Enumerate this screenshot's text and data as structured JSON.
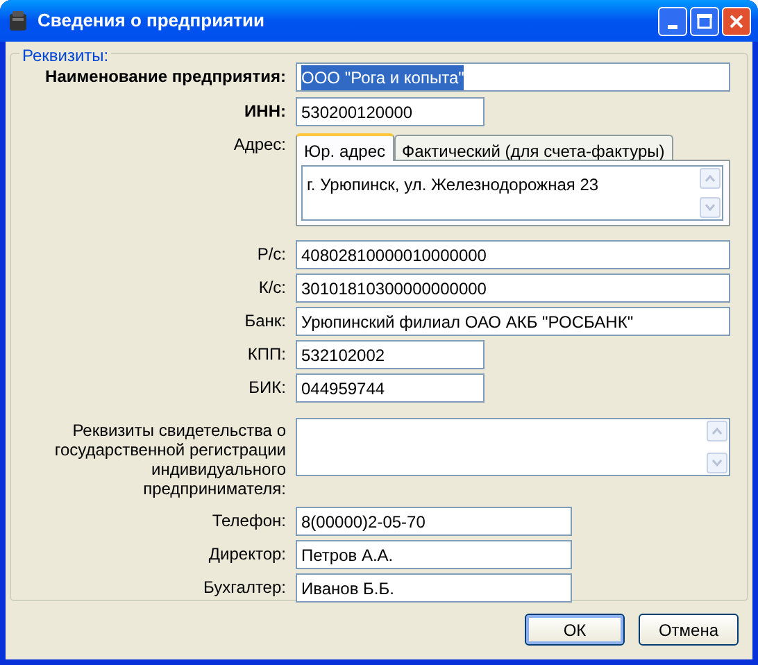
{
  "window": {
    "title": "Сведения о предприятии"
  },
  "group": {
    "legend": "Реквизиты:"
  },
  "name": {
    "label": "Наименование предприятия:",
    "value": "ООО \"Рога и копыта\"",
    "text_selected": true
  },
  "inn": {
    "label": "ИНН:",
    "value": "530200120000"
  },
  "address": {
    "label": "Адрес:",
    "tabs": [
      {
        "label": "Юр. адрес",
        "selected": true
      },
      {
        "label": "Фактический (для счета-фактуры)",
        "selected": false
      }
    ],
    "value": "г. Урюпинск, ул. Железнодорожная 23"
  },
  "bank_fields": [
    {
      "label": "Р/с:",
      "value": "40802810000010000000"
    },
    {
      "label": "К/с:",
      "value": "30101810300000000000"
    },
    {
      "label": "Банк:",
      "value": "Урюпинский филиал ОАО АКБ \"РОСБАНК\""
    },
    {
      "label": "КПП:",
      "value": "532102002"
    },
    {
      "label": "БИК:",
      "value": "044959744"
    }
  ],
  "registration": {
    "label": "Реквизиты свидетельства о государственной регистрации индивидуального предпринимателя:"
  },
  "contact_fields": [
    {
      "label": "Телефон:",
      "value": "8(00000)2-05-70"
    },
    {
      "label": "Директор:",
      "value": "Петров А.А."
    },
    {
      "label": "Бухгалтер:",
      "value": "Иванов Б.Б."
    }
  ],
  "buttons": [
    {
      "label": "ОК",
      "default": true
    },
    {
      "label": "Отмена",
      "default": false
    }
  ]
}
